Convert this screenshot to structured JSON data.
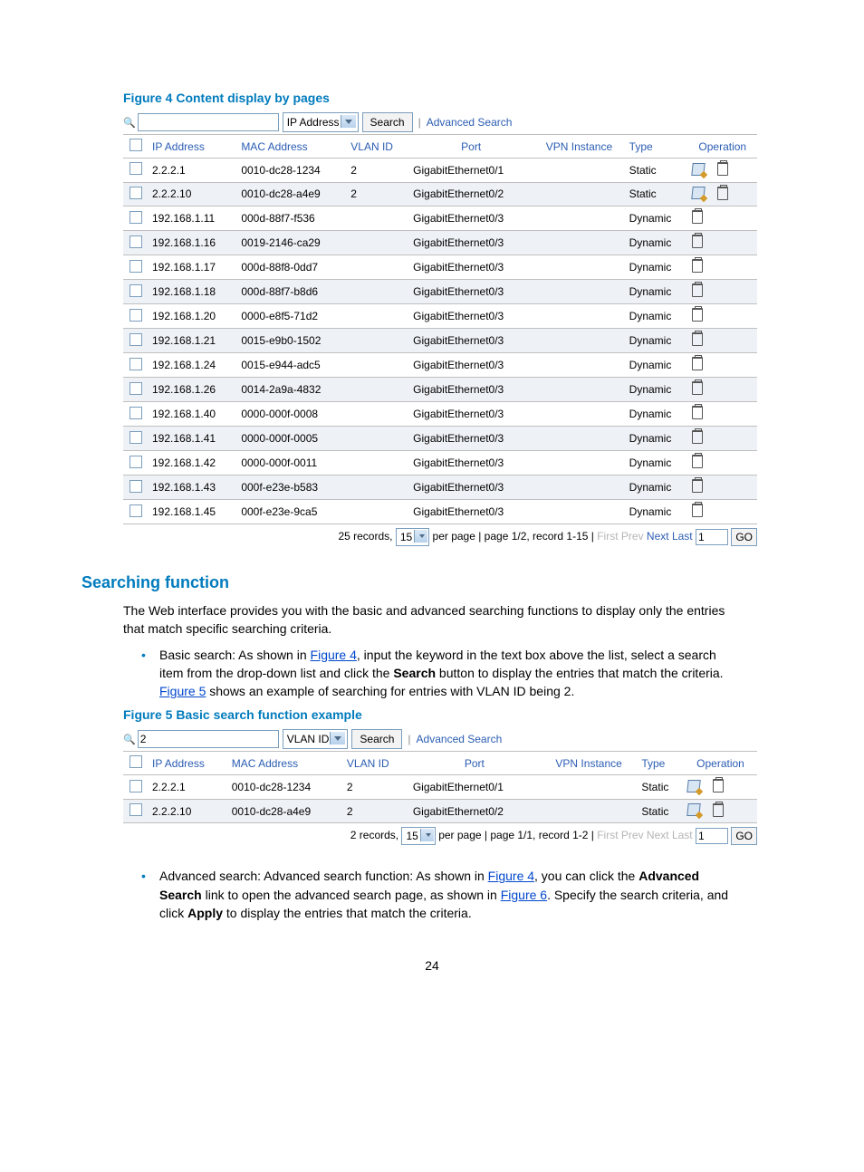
{
  "page_number": "24",
  "fig4_caption": "Figure 4 Content display by pages",
  "fig5_caption": "Figure 5 Basic search function example",
  "section_heading": "Searching function",
  "intro_text": "The Web interface provides you with the basic and advanced searching functions to display only the entries that match specific searching criteria.",
  "bullet1": {
    "prefix": "Basic search: As shown in ",
    "link1": "Figure 4",
    "mid1": ", input the keyword in the text box above the list, select a search item from the drop-down list and click the ",
    "bold1": "Search",
    "mid2": " button to display the entries that match the criteria. ",
    "link2": "Figure 5",
    "suffix": " shows an example of searching for entries with VLAN ID being 2."
  },
  "bullet2": {
    "prefix": "Advanced search: Advanced search function: As shown in ",
    "link1": "Figure 4",
    "mid1": ", you can click the ",
    "bold1": "Advanced Search",
    "mid2": " link to open the advanced search page, as shown in ",
    "link2": "Figure 6",
    "mid3": ". Specify the search criteria, and click ",
    "bold2": "Apply",
    "suffix": " to display the entries that match the criteria."
  },
  "ui": {
    "search_placeholder": "",
    "dropdown_f4": "IP Address",
    "dropdown_f5": "VLAN ID",
    "search_value_f5": "2",
    "search_btn": "Search",
    "adv_link": "Advanced Search",
    "headers": [
      "",
      "IP Address",
      "MAC Address",
      "VLAN ID",
      "Port",
      "VPN Instance",
      "Type",
      "Operation"
    ],
    "pager_f4": {
      "records": "25 records,",
      "per_page": "15",
      "mid": "per page | page 1/2, record 1-15 |",
      "first": "First",
      "prev": "Prev",
      "next": "Next",
      "last": "Last",
      "page_val": "1",
      "go": "GO"
    },
    "pager_f5": {
      "records": "2 records,",
      "per_page": "15",
      "mid": "per page | page 1/1, record 1-2 |",
      "first": "First",
      "prev": "Prev",
      "next": "Next",
      "last": "Last",
      "page_val": "1",
      "go": "GO"
    }
  },
  "chart_data": {
    "type": "table",
    "figure4_rows": [
      {
        "ip": "2.2.2.1",
        "mac": "0010-dc28-1234",
        "vlan": "2",
        "port": "GigabitEthernet0/1",
        "vpn": "",
        "type": "Static",
        "edit": true
      },
      {
        "ip": "2.2.2.10",
        "mac": "0010-dc28-a4e9",
        "vlan": "2",
        "port": "GigabitEthernet0/2",
        "vpn": "",
        "type": "Static",
        "edit": true
      },
      {
        "ip": "192.168.1.11",
        "mac": "000d-88f7-f536",
        "vlan": "",
        "port": "GigabitEthernet0/3",
        "vpn": "",
        "type": "Dynamic",
        "edit": false
      },
      {
        "ip": "192.168.1.16",
        "mac": "0019-2146-ca29",
        "vlan": "",
        "port": "GigabitEthernet0/3",
        "vpn": "",
        "type": "Dynamic",
        "edit": false
      },
      {
        "ip": "192.168.1.17",
        "mac": "000d-88f8-0dd7",
        "vlan": "",
        "port": "GigabitEthernet0/3",
        "vpn": "",
        "type": "Dynamic",
        "edit": false
      },
      {
        "ip": "192.168.1.18",
        "mac": "000d-88f7-b8d6",
        "vlan": "",
        "port": "GigabitEthernet0/3",
        "vpn": "",
        "type": "Dynamic",
        "edit": false
      },
      {
        "ip": "192.168.1.20",
        "mac": "0000-e8f5-71d2",
        "vlan": "",
        "port": "GigabitEthernet0/3",
        "vpn": "",
        "type": "Dynamic",
        "edit": false
      },
      {
        "ip": "192.168.1.21",
        "mac": "0015-e9b0-1502",
        "vlan": "",
        "port": "GigabitEthernet0/3",
        "vpn": "",
        "type": "Dynamic",
        "edit": false
      },
      {
        "ip": "192.168.1.24",
        "mac": "0015-e944-adc5",
        "vlan": "",
        "port": "GigabitEthernet0/3",
        "vpn": "",
        "type": "Dynamic",
        "edit": false
      },
      {
        "ip": "192.168.1.26",
        "mac": "0014-2a9a-4832",
        "vlan": "",
        "port": "GigabitEthernet0/3",
        "vpn": "",
        "type": "Dynamic",
        "edit": false
      },
      {
        "ip": "192.168.1.40",
        "mac": "0000-000f-0008",
        "vlan": "",
        "port": "GigabitEthernet0/3",
        "vpn": "",
        "type": "Dynamic",
        "edit": false
      },
      {
        "ip": "192.168.1.41",
        "mac": "0000-000f-0005",
        "vlan": "",
        "port": "GigabitEthernet0/3",
        "vpn": "",
        "type": "Dynamic",
        "edit": false
      },
      {
        "ip": "192.168.1.42",
        "mac": "0000-000f-0011",
        "vlan": "",
        "port": "GigabitEthernet0/3",
        "vpn": "",
        "type": "Dynamic",
        "edit": false
      },
      {
        "ip": "192.168.1.43",
        "mac": "000f-e23e-b583",
        "vlan": "",
        "port": "GigabitEthernet0/3",
        "vpn": "",
        "type": "Dynamic",
        "edit": false
      },
      {
        "ip": "192.168.1.45",
        "mac": "000f-e23e-9ca5",
        "vlan": "",
        "port": "GigabitEthernet0/3",
        "vpn": "",
        "type": "Dynamic",
        "edit": false
      }
    ],
    "figure5_rows": [
      {
        "ip": "2.2.2.1",
        "mac": "0010-dc28-1234",
        "vlan": "2",
        "port": "GigabitEthernet0/1",
        "vpn": "",
        "type": "Static",
        "edit": true
      },
      {
        "ip": "2.2.2.10",
        "mac": "0010-dc28-a4e9",
        "vlan": "2",
        "port": "GigabitEthernet0/2",
        "vpn": "",
        "type": "Static",
        "edit": true
      }
    ]
  }
}
